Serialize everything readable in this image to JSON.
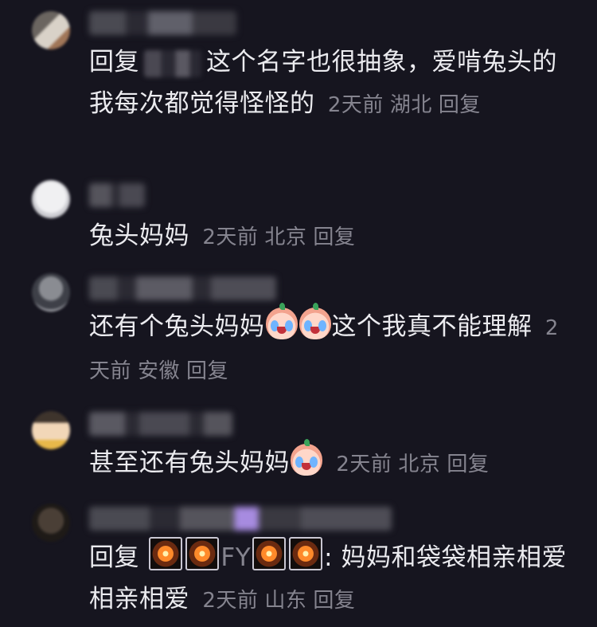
{
  "comments": [
    {
      "body_prefix": "回复",
      "body_text": "这个名字也很抽象，爱啃兔头的我每次都觉得怪怪的",
      "meta": {
        "time": "2天前",
        "location": "湖北",
        "reply": "回复"
      }
    },
    {
      "body_text": "兔头妈妈",
      "meta": {
        "time": "2天前",
        "location": "北京",
        "reply": "回复"
      }
    },
    {
      "body_text_a": "还有个兔头妈妈",
      "body_text_b": "这个我真不能理解",
      "meta": {
        "time": "2天前",
        "location": "安徽",
        "reply": "回复"
      }
    },
    {
      "body_text": "甚至还有兔头妈妈",
      "meta": {
        "time": "2天前",
        "location": "北京",
        "reply": "回复"
      }
    },
    {
      "body_prefix": "回复",
      "mention_mid": "FY",
      "body_text": ": 妈妈和袋袋相亲相爱相亲相爱",
      "meta": {
        "time": "2天前",
        "location": "山东",
        "reply": "回复"
      }
    }
  ],
  "icons": {
    "emoji": "crying-face-emoji",
    "firework": "firework-emoji"
  },
  "colors": {
    "background": "#16151f",
    "text": "#ebebef",
    "meta": "#85848f"
  }
}
